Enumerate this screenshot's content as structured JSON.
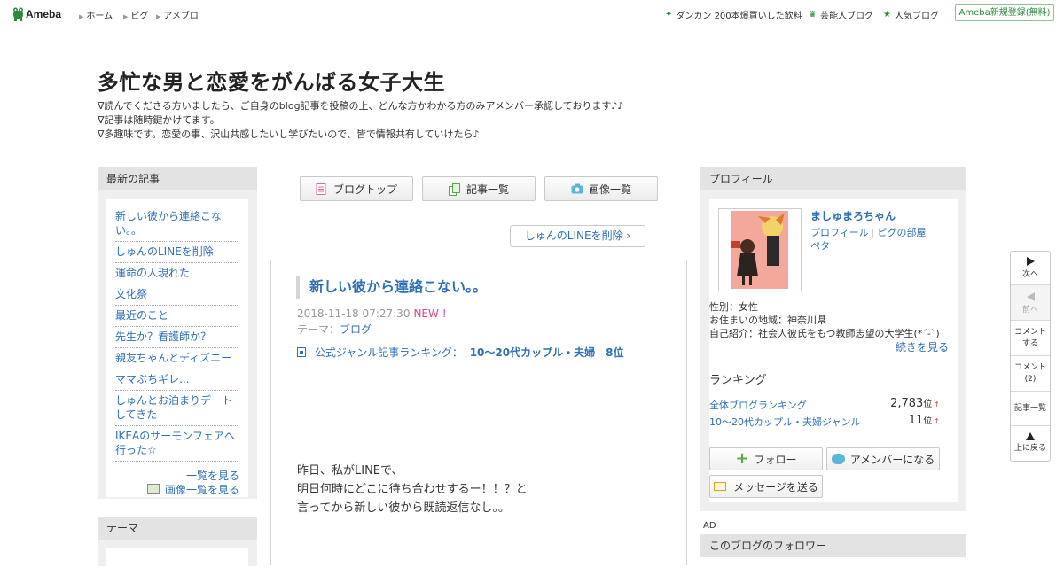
{
  "header": {
    "logo_text": "Ameba",
    "nav": [
      "ホーム",
      "ピグ",
      "アメブロ"
    ],
    "promo": "ダンカン 200本爆買いした飲料",
    "celeb_blog": "芸能人ブログ",
    "popular_blog": "人気ブログ",
    "register": "Ameba新規登録(無料)"
  },
  "blog": {
    "title": "多忙な男と恋愛をがんばる女子大生",
    "desc": [
      "∇読んでくださる方いましたら、ご自身のblog記事を投稿の上、どんな方かわかる方のみアメンバー承認しております♪♪",
      "∇記事は随時鍵かけてます。",
      "∇多趣味です。恋愛の事、沢山共感したいし学びたいので、皆で情報共有していけたら♪"
    ]
  },
  "sidebar": {
    "latest_title": "最新の記事",
    "articles": [
      "新しい彼から連絡こない。。",
      "しゅんのLINEを削除",
      "運命の人現れた",
      "文化祭",
      "最近のこと",
      "先生か？看護師か？",
      "親友ちゃんとディズニー",
      "ママぶちギレ...",
      "しゅんとお泊まりデートしてきた",
      "IKEAのサーモンフェアへ行った☆"
    ],
    "see_all": "一覧を見る",
    "see_images": "画像一覧を見る",
    "theme_title": "テーマ"
  },
  "nav_buttons": {
    "top": "ブログトップ",
    "list": "記事一覧",
    "images": "画像一覧"
  },
  "next_post": "しゅんのLINEを削除",
  "post": {
    "title": "新しい彼から連絡こない。。",
    "date": "2018-11-18 07:27:30",
    "new_badge": "NEW !",
    "theme_label": "テーマ：",
    "theme": "ブログ",
    "ranking_label": "公式ジャンル記事ランキング：",
    "ranking_value": "10〜20代カップル・夫婦　8位",
    "body": [
      "昨日、私がLINEで、",
      "明日何時にどこに待ち合わせするー！！？と",
      "言ってから新しい彼から既読返信なし。。"
    ]
  },
  "profile": {
    "title": "プロフィール",
    "name": "ましゅまろちゃん",
    "link_profile": "プロフィール",
    "link_pig": "ピグの部屋",
    "link_peta": "ペタ",
    "gender": "性別：女性",
    "location": "お住まいの地域：神奈川県",
    "intro": "自己紹介：社会人彼氏をもつ教師志望の大学生(*´-`)",
    "more": "続きを見る",
    "ranking_title": "ランキング",
    "rank_all_label": "全体ブログランキング",
    "rank_all_value": "2,783",
    "rank_genre_label": "10〜20代カップル・夫婦ジャンル",
    "rank_genre_value": "11",
    "rank_unit": "位",
    "rank_trend": "↑",
    "follow": "フォロー",
    "amember": "アメンバーになる",
    "message": "メッセージを送る",
    "ad": "AD",
    "followers_title": "このブログのフォロワー"
  },
  "float_nav": {
    "next": "次へ",
    "prev": "前へ",
    "comment_line1": "コメント",
    "comment_line2": "する",
    "comments_line1": "コメント",
    "comments_line2": "(2)",
    "list": "記事一覧",
    "top": "上に戻る"
  }
}
